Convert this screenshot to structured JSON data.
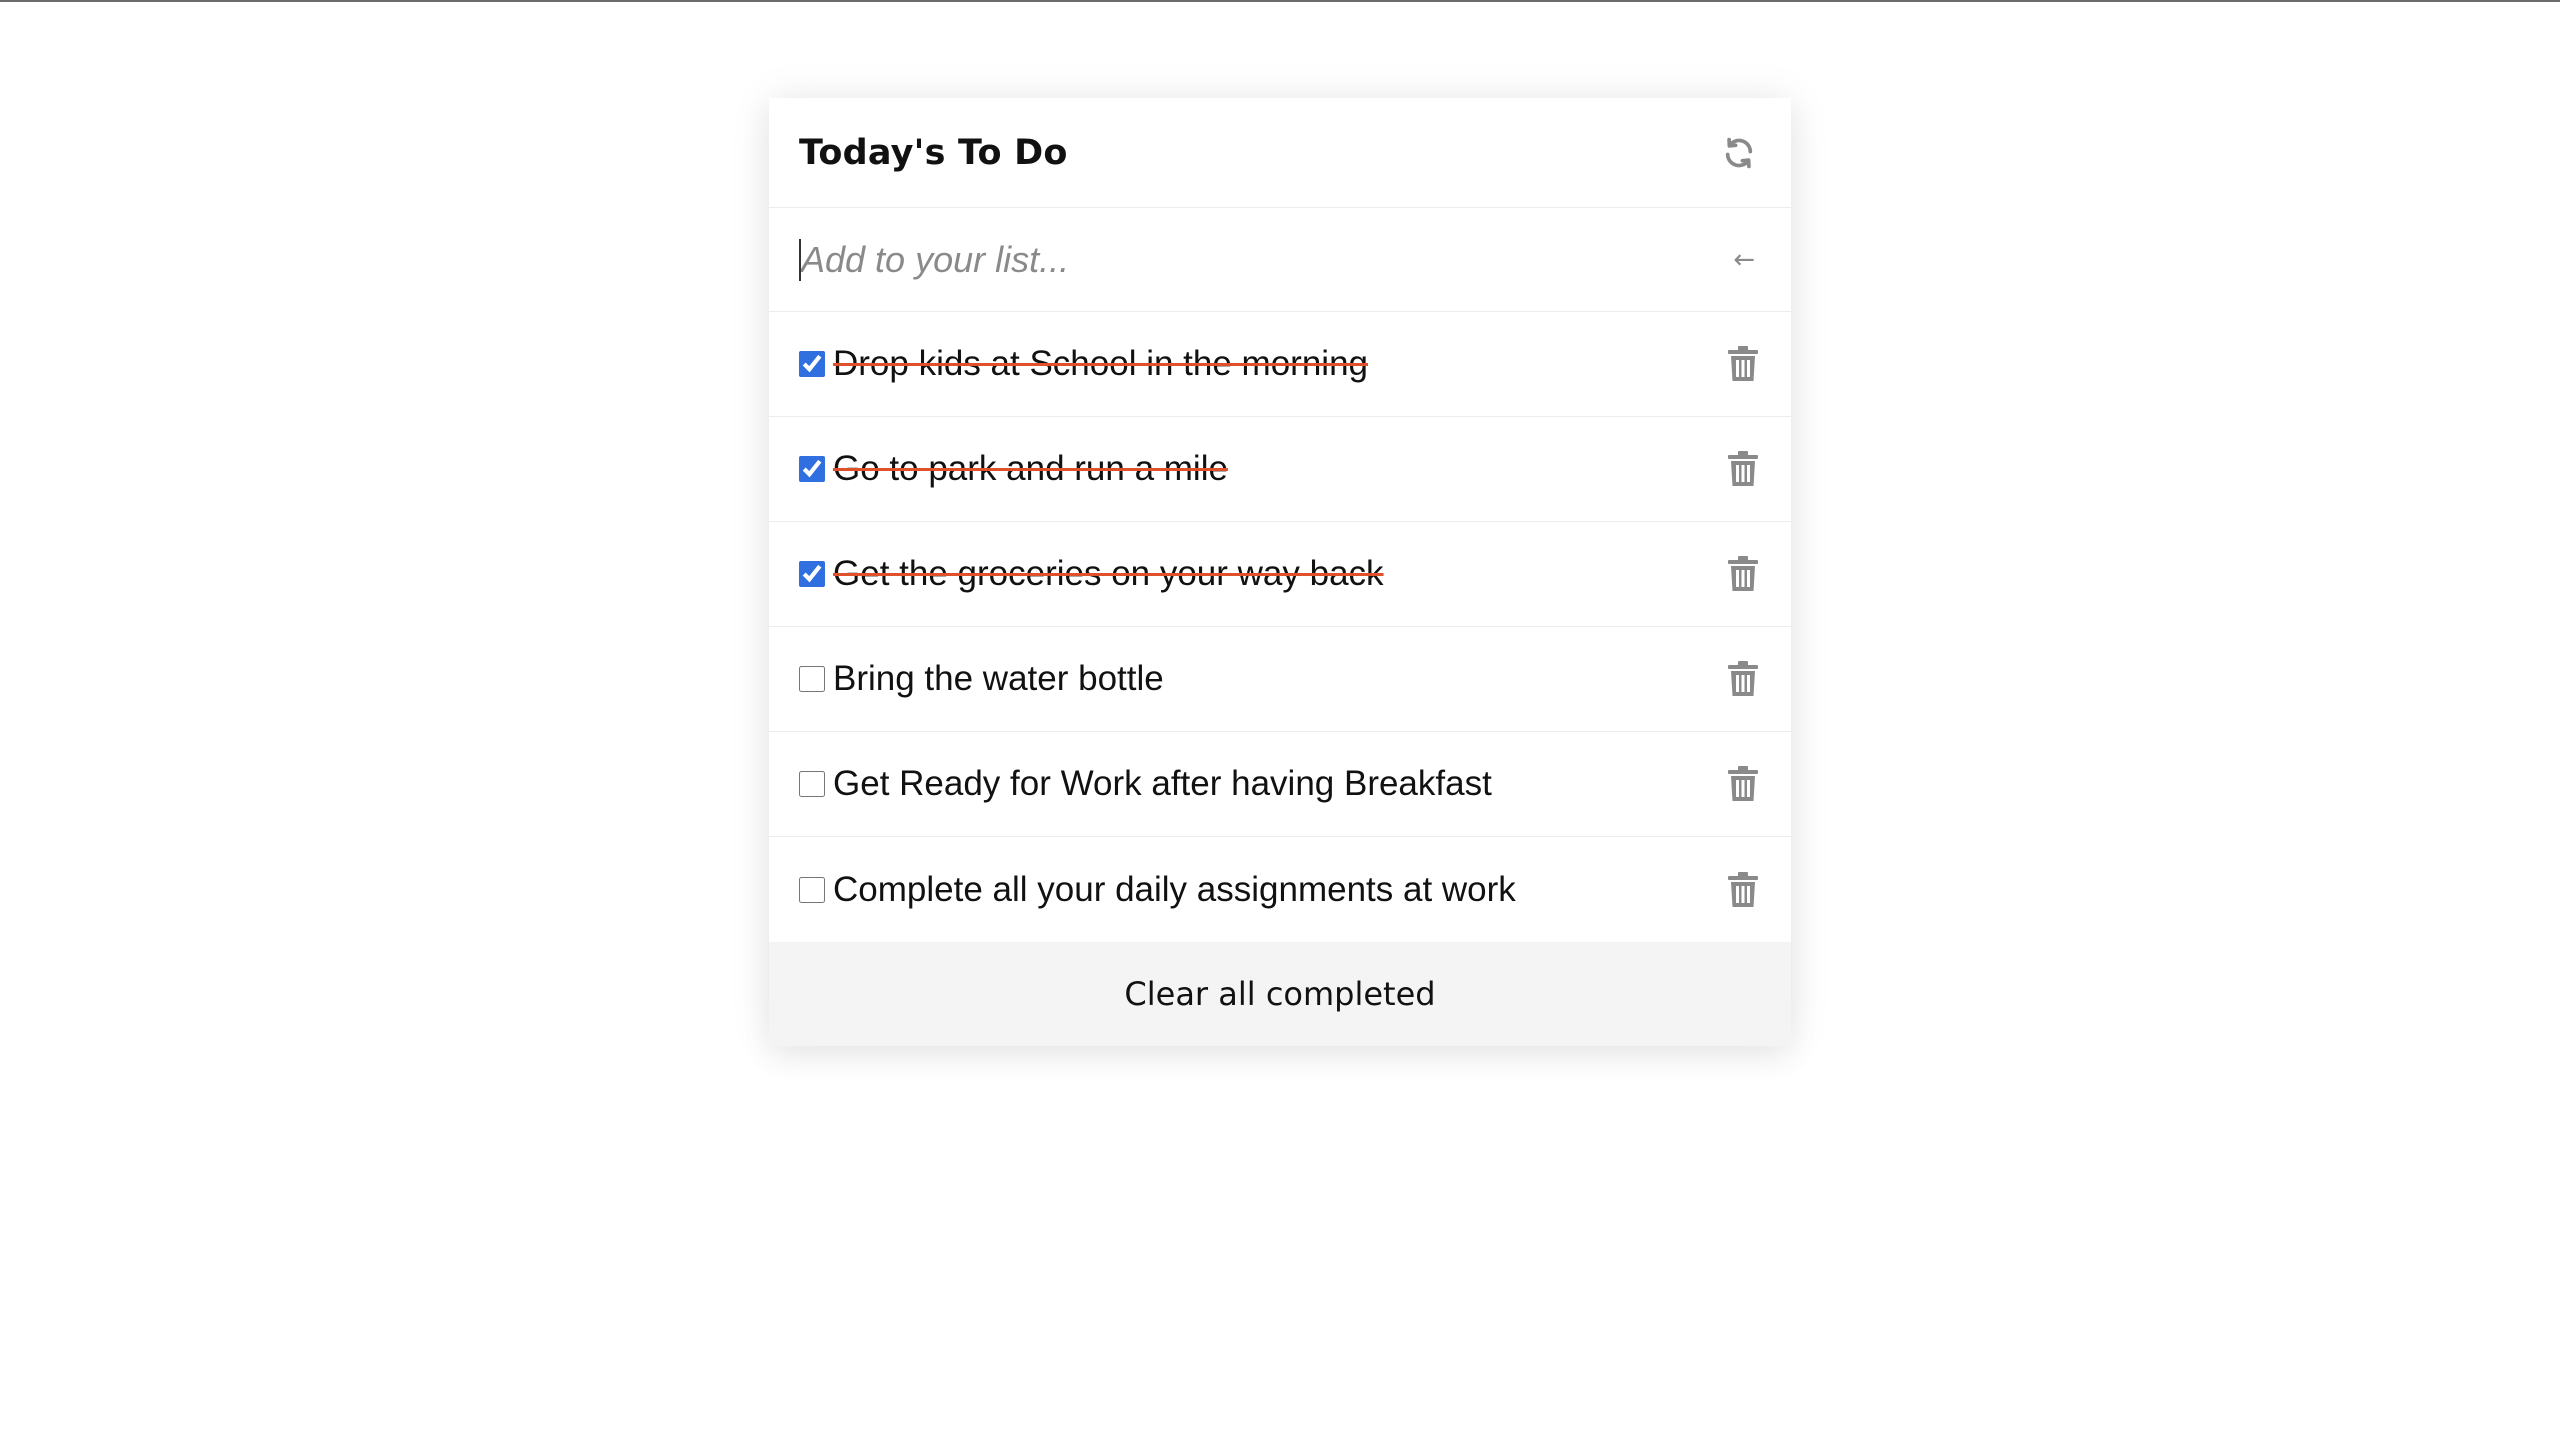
{
  "header": {
    "title": "Today's To Do",
    "refresh_icon": "refresh-icon"
  },
  "add": {
    "placeholder": "Add to your list...",
    "value": "",
    "submit_icon": "arrow-left-icon",
    "submit_glyph": "←"
  },
  "todos": [
    {
      "text": "Drop kids at School in the morning",
      "done": true
    },
    {
      "text": "Go to park and run a mile",
      "done": true
    },
    {
      "text": "Get the groceries on your way back",
      "done": true
    },
    {
      "text": "Bring the water bottle",
      "done": false
    },
    {
      "text": "Get Ready for Work after having Breakfast",
      "done": false
    },
    {
      "text": "Complete all your daily assignments at work",
      "done": false
    }
  ],
  "footer": {
    "clear_label": "Clear all completed"
  },
  "colors": {
    "checkbox_accent": "#2f6fe0",
    "strike": "#e0502a",
    "icon": "#8a8a8a",
    "footer_bg": "#f4f4f4"
  }
}
